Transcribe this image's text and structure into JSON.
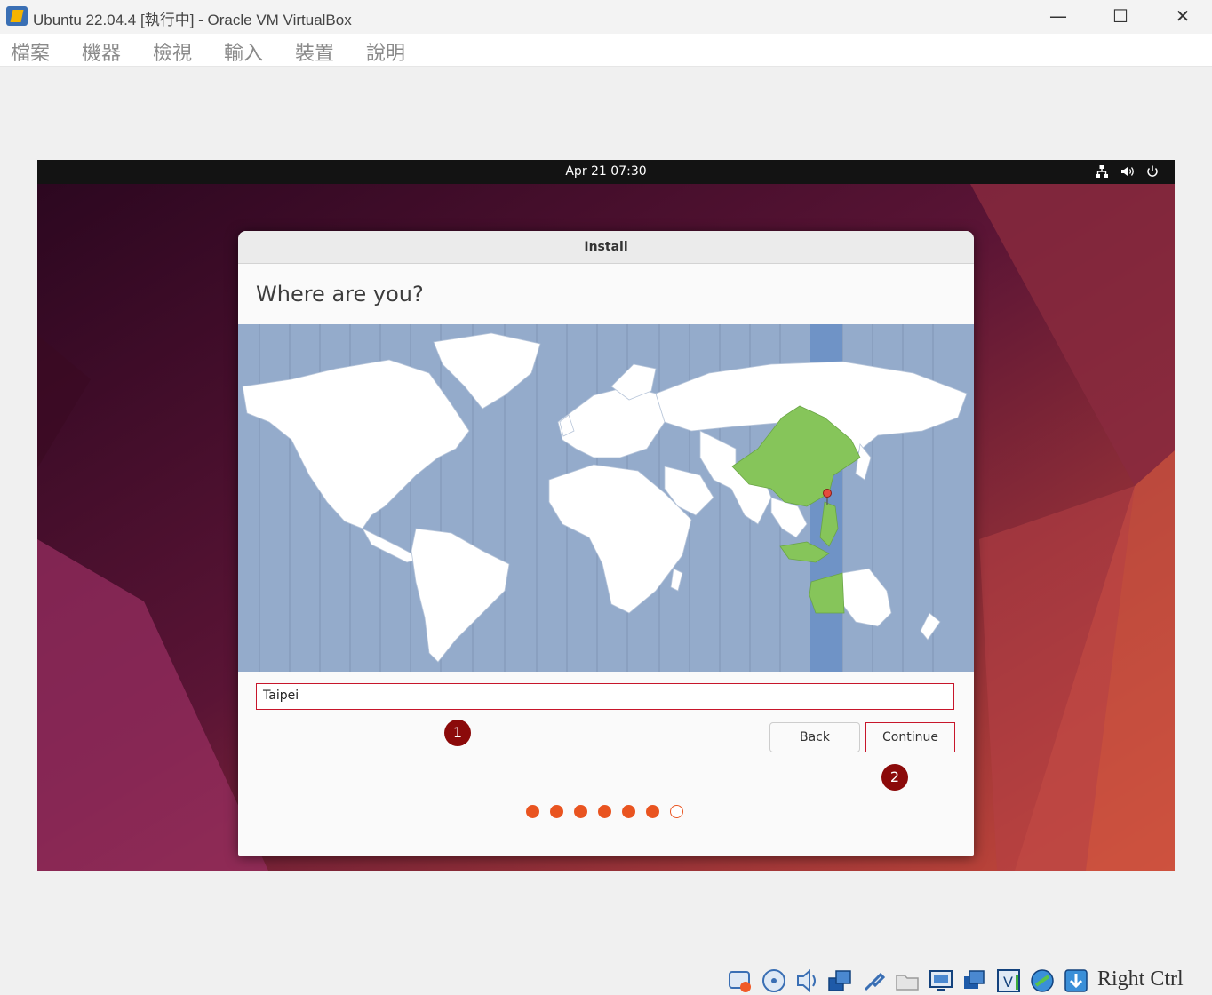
{
  "window": {
    "title": "Ubuntu 22.04.4 [執行中] - Oracle VM VirtualBox",
    "minimize": "—",
    "maximize": "☐",
    "close": "✕"
  },
  "menu": {
    "items": [
      "檔案",
      "機器",
      "檢視",
      "輸入",
      "裝置",
      "說明"
    ]
  },
  "guest": {
    "clock": "Apr 21  07:30",
    "tray_icons": [
      "network-icon",
      "volume-icon",
      "power-icon"
    ]
  },
  "installer": {
    "title": "Install",
    "heading": "Where are you?",
    "timezone_value": "Taipei",
    "back_label": "Back",
    "continue_label": "Continue",
    "progress_total": 7,
    "progress_current": 6,
    "accent_color": "#e95420",
    "highlight_color": "#c7162b"
  },
  "annotations": {
    "marker1": "1",
    "marker2": "2"
  },
  "statusbar": {
    "host_key": "Right Ctrl",
    "icons": [
      "hard-disk-icon",
      "optical-drive-icon",
      "audio-icon",
      "network-adapter-icon",
      "usb-icon",
      "shared-folders-icon",
      "display-icon",
      "video-capture-icon",
      "virtualization-icon",
      "guest-additions-icon",
      "mouse-integration-icon"
    ]
  }
}
